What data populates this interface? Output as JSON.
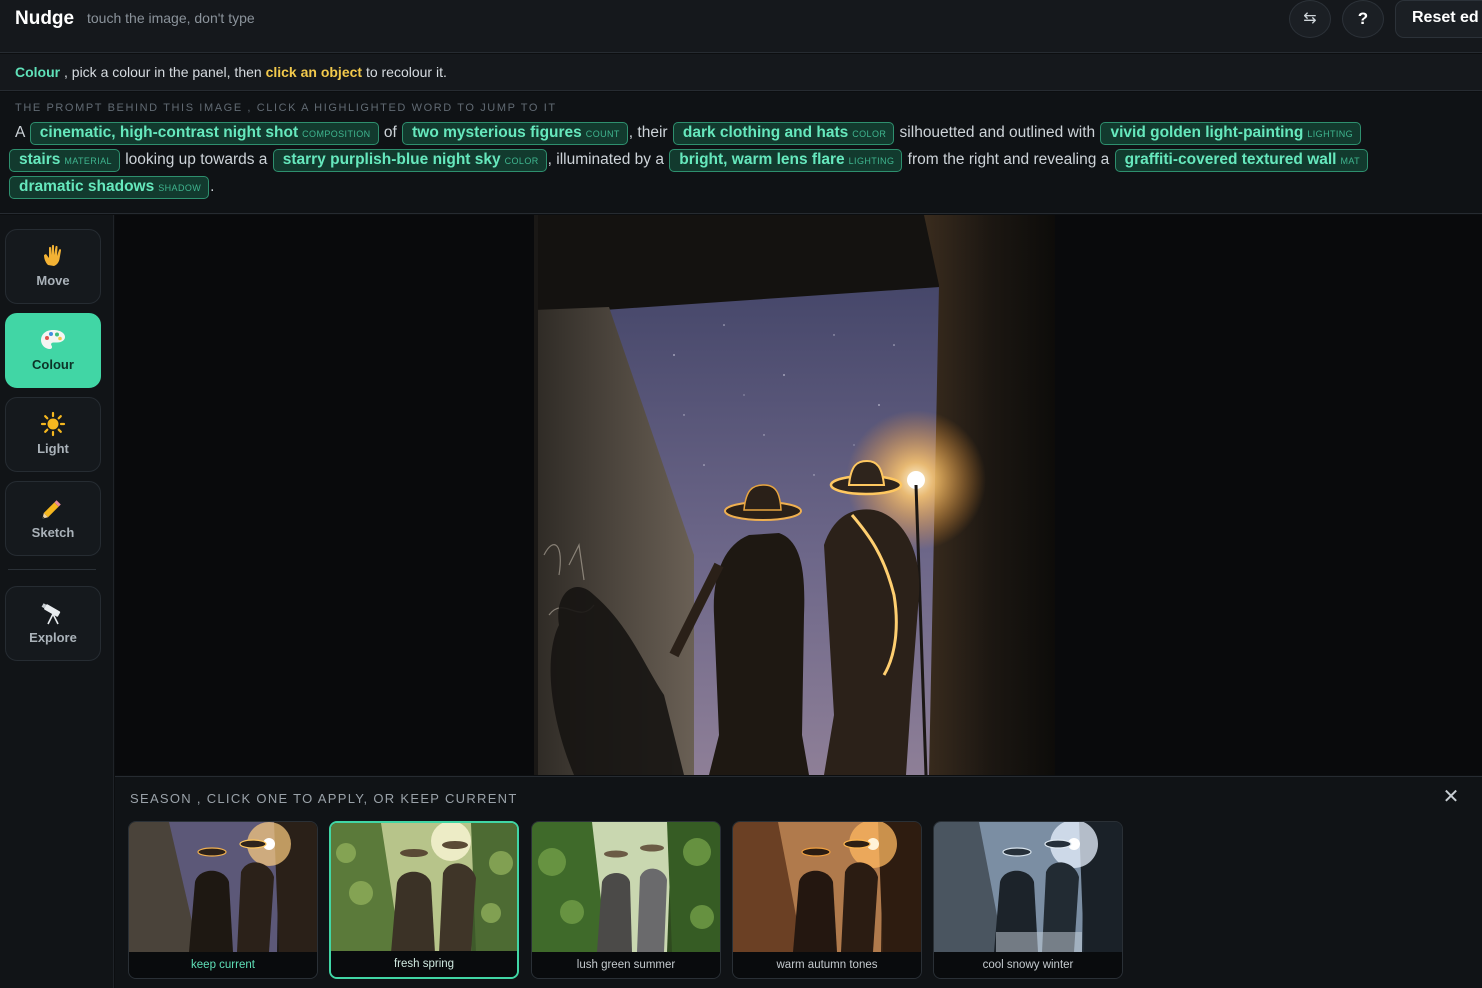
{
  "app": {
    "name": "Nudge",
    "tagline": "touch the image, don't type",
    "help_label": "?",
    "reset_label": "Reset ed"
  },
  "instruction": {
    "mode": "Colour",
    "part1": " , pick a colour in the panel, then ",
    "highlight": "click an object",
    "part2": " to recolour it."
  },
  "prompt": {
    "hint": "The prompt behind this image , click a highlighted word to jump to it",
    "t0": "A ",
    "chips": [
      {
        "text": "cinematic, high-contrast night shot",
        "tag": "composition"
      },
      {
        "text": "two mysterious figures",
        "tag": "count"
      },
      {
        "text": "dark clothing and hats",
        "tag": "color"
      },
      {
        "text": "vivid golden light-painting",
        "tag": "lighting"
      },
      {
        "text": "stairs",
        "tag": "material"
      },
      {
        "text": "starry purplish-blue night sky",
        "tag": "color"
      },
      {
        "text": "bright, warm lens flare",
        "tag": "lighting"
      },
      {
        "text": "graffiti-covered textured wall",
        "tag": "mat"
      },
      {
        "text": "dramatic shadows",
        "tag": "shadow"
      }
    ],
    "t1": " of ",
    "t2": ", their ",
    "t3": " silhouetted and outlined with ",
    "t4": " looking up towards a ",
    "t5": ", illuminated by a ",
    "t6": " from the right and revealing a ",
    "t7": "."
  },
  "tools": [
    {
      "label": "Move",
      "icon": "hand-icon"
    },
    {
      "label": "Colour",
      "icon": "palette-icon",
      "active": true
    },
    {
      "label": "Light",
      "icon": "sun-icon"
    },
    {
      "label": "Sketch",
      "icon": "pencil-icon"
    },
    {
      "label": "Explore",
      "icon": "telescope-icon"
    }
  ],
  "season_panel": {
    "title": "Season , click one to apply, or keep current",
    "close_icon": "close-icon",
    "options": [
      {
        "label": "keep current"
      },
      {
        "label": "fresh spring",
        "selected": true
      },
      {
        "label": "lush green summer"
      },
      {
        "label": "warm autumn tones"
      },
      {
        "label": "cool snowy winter"
      }
    ]
  },
  "colors": {
    "accent": "#41d6a5",
    "chip_text": "#66e8bd",
    "highlight": "#f2c94c",
    "background": "#0c0e10"
  }
}
